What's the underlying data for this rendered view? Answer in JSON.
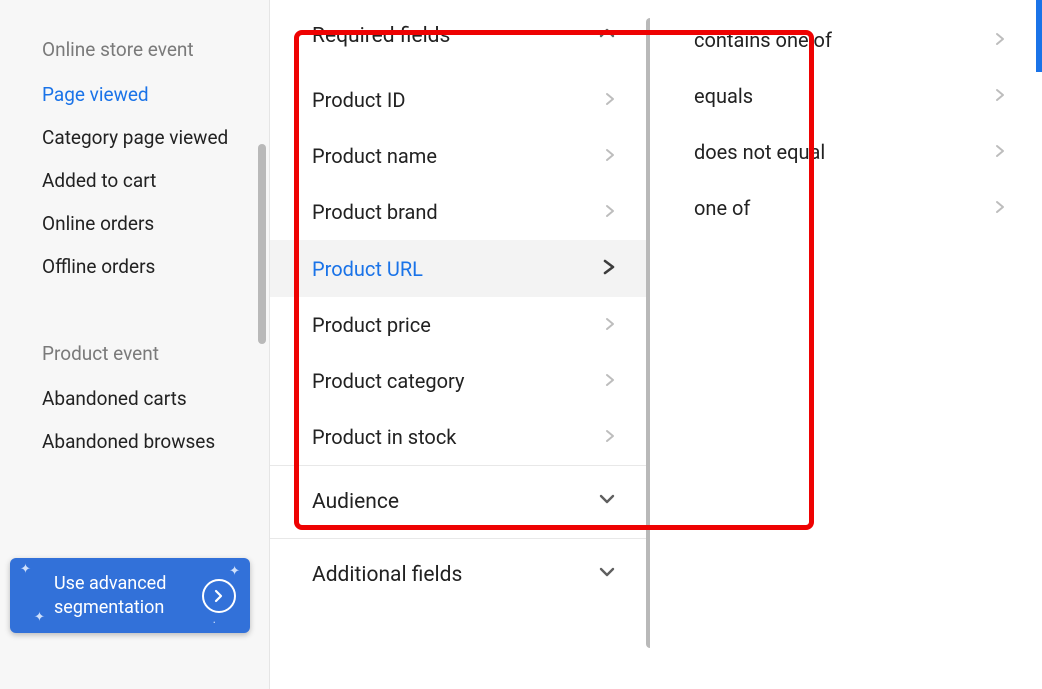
{
  "sidebar": {
    "section1_heading": "Online store event",
    "items1": [
      {
        "label": "Page viewed",
        "selected": true
      },
      {
        "label": "Category page viewed",
        "selected": false
      },
      {
        "label": "Added to cart",
        "selected": false
      },
      {
        "label": "Online orders",
        "selected": false
      },
      {
        "label": "Offline orders",
        "selected": false
      }
    ],
    "section2_heading": "Product event",
    "items2": [
      {
        "label": "Abandoned carts",
        "selected": false
      },
      {
        "label": "Abandoned browses",
        "selected": false
      }
    ],
    "adv_btn": "Use advanced segmentation"
  },
  "middle": {
    "group_required": "Required fields",
    "fields": [
      {
        "label": "Product ID",
        "selected": false
      },
      {
        "label": "Product name",
        "selected": false
      },
      {
        "label": "Product brand",
        "selected": false
      },
      {
        "label": "Product URL",
        "selected": true
      },
      {
        "label": "Product price",
        "selected": false
      },
      {
        "label": "Product category",
        "selected": false
      },
      {
        "label": "Product in stock",
        "selected": false
      }
    ],
    "group_audience": "Audience",
    "group_additional": "Additional fields"
  },
  "right": {
    "operators": [
      {
        "label": "contains one of"
      },
      {
        "label": "equals"
      },
      {
        "label": "does not equal"
      },
      {
        "label": "one of"
      }
    ]
  }
}
